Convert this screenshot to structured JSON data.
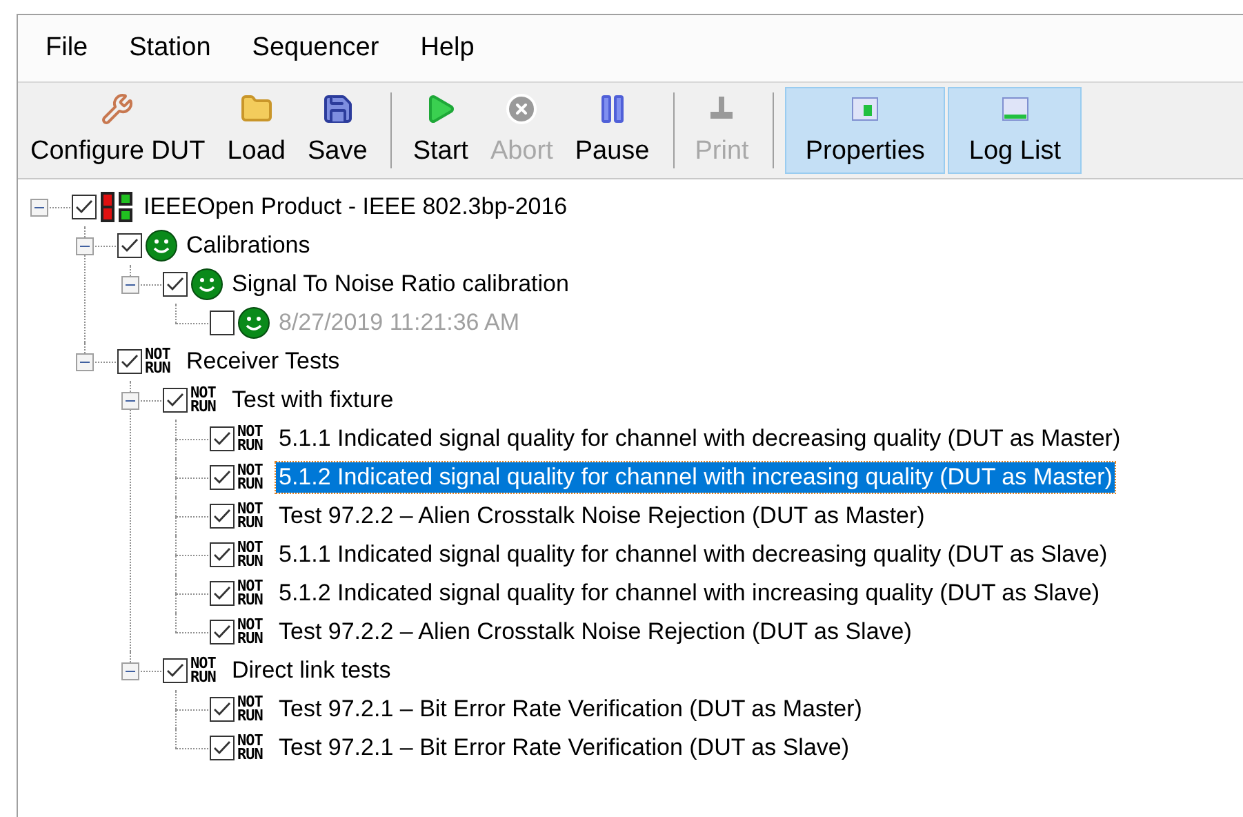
{
  "menu": [
    {
      "label": "File"
    },
    {
      "label": "Station"
    },
    {
      "label": "Sequencer"
    },
    {
      "label": "Help"
    }
  ],
  "toolbar": [
    {
      "kind": "button",
      "label": "Configure DUT",
      "disabled": false,
      "selected": false
    },
    {
      "kind": "button",
      "label": "Load",
      "disabled": false,
      "selected": false
    },
    {
      "kind": "button",
      "label": "Save",
      "disabled": false,
      "selected": false
    },
    {
      "kind": "separator"
    },
    {
      "kind": "button",
      "label": "Start",
      "disabled": false,
      "selected": false
    },
    {
      "kind": "button",
      "label": "Abort",
      "disabled": true,
      "selected": false
    },
    {
      "kind": "button",
      "label": "Pause",
      "disabled": false,
      "selected": false
    },
    {
      "kind": "separator"
    },
    {
      "kind": "button",
      "label": "Print",
      "disabled": true,
      "selected": false
    },
    {
      "kind": "separator"
    },
    {
      "kind": "button",
      "label": "Properties",
      "disabled": false,
      "selected": true
    },
    {
      "kind": "button",
      "label": "Log List",
      "disabled": false,
      "selected": true
    }
  ],
  "tree": [
    {
      "label": "IEEEOpen Product  -  IEEE 802.3bp-2016",
      "checked": true,
      "expanded": true,
      "selected": false,
      "status": {
        "kind": "product"
      },
      "children": [
        {
          "label": "Calibrations",
          "checked": true,
          "expanded": true,
          "selected": false,
          "status": {
            "kind": "pass"
          },
          "children": [
            {
              "label": "Signal To Noise Ratio calibration",
              "checked": true,
              "expanded": true,
              "selected": false,
              "status": {
                "kind": "pass"
              },
              "children": [
                {
                  "label": "8/27/2019 11:21:36 AM",
                  "checked": false,
                  "selected": false,
                  "dimmed": true,
                  "status": {
                    "kind": "pass"
                  }
                }
              ]
            }
          ]
        },
        {
          "label": "Receiver Tests",
          "checked": true,
          "expanded": true,
          "selected": false,
          "status": {
            "kind": "not_run",
            "text": "NOT RUN"
          },
          "children": [
            {
              "label": "Test with fixture",
              "checked": true,
              "expanded": true,
              "selected": false,
              "status": {
                "kind": "not_run",
                "text": "NOT RUN"
              },
              "children": [
                {
                  "label": "5.1.1 Indicated signal quality for channel with decreasing quality (DUT as Master)",
                  "checked": true,
                  "selected": false,
                  "status": {
                    "kind": "not_run",
                    "text": "NOT RUN"
                  }
                },
                {
                  "label": "5.1.2 Indicated signal quality for channel with increasing quality (DUT as Master)",
                  "checked": true,
                  "selected": true,
                  "status": {
                    "kind": "not_run",
                    "text": "NOT RUN"
                  }
                },
                {
                  "label": "Test 97.2.2 – Alien Crosstalk Noise Rejection (DUT as Master)",
                  "checked": true,
                  "selected": false,
                  "status": {
                    "kind": "not_run",
                    "text": "NOT RUN"
                  }
                },
                {
                  "label": "5.1.1 Indicated signal quality for channel with decreasing quality (DUT as Slave)",
                  "checked": true,
                  "selected": false,
                  "status": {
                    "kind": "not_run",
                    "text": "NOT RUN"
                  }
                },
                {
                  "label": "5.1.2 Indicated signal quality for channel with increasing quality (DUT as Slave)",
                  "checked": true,
                  "selected": false,
                  "status": {
                    "kind": "not_run",
                    "text": "NOT RUN"
                  }
                },
                {
                  "label": "Test 97.2.2 – Alien Crosstalk Noise Rejection (DUT as Slave)",
                  "checked": true,
                  "selected": false,
                  "status": {
                    "kind": "not_run",
                    "text": "NOT RUN"
                  }
                }
              ]
            },
            {
              "label": "Direct link tests",
              "checked": true,
              "expanded": true,
              "selected": false,
              "status": {
                "kind": "not_run",
                "text": "NOT RUN"
              },
              "children": [
                {
                  "label": "Test 97.2.1 – Bit Error Rate Verification (DUT as Master)",
                  "checked": true,
                  "selected": false,
                  "status": {
                    "kind": "not_run",
                    "text": "NOT RUN"
                  }
                },
                {
                  "label": "Test 97.2.1 – Bit Error Rate Verification (DUT as Slave)",
                  "checked": true,
                  "selected": false,
                  "status": {
                    "kind": "not_run",
                    "text": "NOT RUN"
                  }
                }
              ]
            }
          ]
        }
      ]
    }
  ]
}
